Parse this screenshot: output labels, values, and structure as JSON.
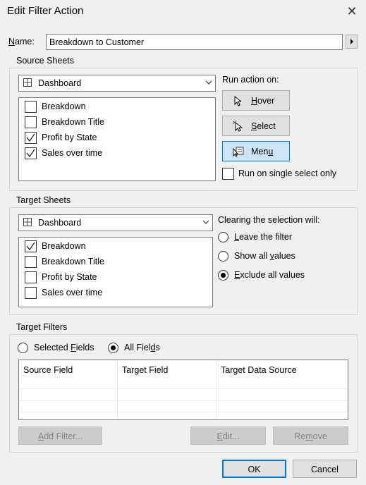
{
  "window": {
    "title": "Edit Filter Action"
  },
  "name_field": {
    "label_pre": "",
    "label_u": "N",
    "label_post": "ame:",
    "value": "Breakdown to Customer"
  },
  "source": {
    "group_label": "Source Sheets",
    "dropdown_value": "Dashboard",
    "sheets": [
      {
        "label": "Breakdown",
        "checked": false
      },
      {
        "label": "Breakdown Title",
        "checked": false
      },
      {
        "label": "Profit by State",
        "checked": true
      },
      {
        "label": "Sales over time",
        "checked": true
      }
    ]
  },
  "run_action": {
    "label": "Run action on:",
    "hover": {
      "u": "H",
      "rest": "over"
    },
    "select": {
      "u": "S",
      "rest": "elect"
    },
    "menu": {
      "pre": "Men",
      "u": "u",
      "rest": ""
    },
    "single_select_label": "Run on single select only",
    "selected": "Menu"
  },
  "target": {
    "group_label": "Target Sheets",
    "dropdown_value": "Dashboard",
    "sheets": [
      {
        "label": "Breakdown",
        "checked": true
      },
      {
        "label": "Breakdown Title",
        "checked": false
      },
      {
        "label": "Profit by State",
        "checked": false
      },
      {
        "label": "Sales over time",
        "checked": false
      }
    ]
  },
  "clearing": {
    "label": "Clearing the selection will:",
    "leave": {
      "u": "L",
      "rest": "eave the filter"
    },
    "show": {
      "pre": "Show all ",
      "u": "v",
      "rest": "alues"
    },
    "exclude": {
      "u": "E",
      "rest": "xclude all values"
    },
    "selected": "exclude"
  },
  "target_filters": {
    "group_label": "Target Filters",
    "selected_fields": {
      "pre": "Selected ",
      "u": "F",
      "rest": "ields"
    },
    "all_fields": {
      "pre": "All Fiel",
      "u": "d",
      "rest": "s"
    },
    "selected": "all",
    "columns": [
      "Source Field",
      "Target Field",
      "Target Data Source"
    ],
    "add_filter": {
      "u": "A",
      "rest": "dd Filter..."
    },
    "edit": {
      "u": "E",
      "rest": "dit..."
    },
    "remove": {
      "pre": "Re",
      "u": "m",
      "rest": "ove"
    }
  },
  "footer": {
    "ok": "OK",
    "cancel": "Cancel"
  },
  "colors": {
    "accent": "#0078d7",
    "selected_button": "#cce4f7"
  }
}
